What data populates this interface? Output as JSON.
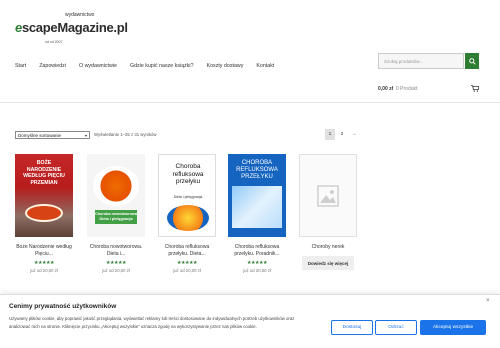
{
  "header": {
    "logo_top": "wydawnictwo",
    "logo_e": "e",
    "logo_rest_1": "scape",
    "logo_rest_2": "Magazine.pl",
    "logo_since": "od od 2007"
  },
  "nav": [
    "Start",
    "Zapowiedzi",
    "O wydawnictwie",
    "Gdzie kupić nasze książki?",
    "Koszty dostawy",
    "Kontakt"
  ],
  "search": {
    "placeholder": "Szukaj produktów..."
  },
  "cart": {
    "amount": "0,00 zł",
    "count": "0 Produkt"
  },
  "toolbar": {
    "sort_selected": "Domyślne sortowanie",
    "results": "Wyświetlanie 1–25 z 31 wyników",
    "pages": [
      "1",
      "2",
      "→"
    ]
  },
  "products": [
    {
      "title": "Boże Narodzenie według Pięciu...",
      "stars": "★★★★★",
      "price": "już od 20,00 zł",
      "cover_text": "BOŻE NARODZENIE WEDŁUG PIĘCIU PRZEMIAN"
    },
    {
      "title": "Choroba nowotworowa. Dieta i...",
      "stars": "★★★★★",
      "price": "już od 20,00 zł",
      "cover_text": "Choroba nowotworowa Dieta i pielęgnacja"
    },
    {
      "title": "Choroba refluksowa przełyku. Dieta...",
      "stars": "★★★★★",
      "price": "już od 20,00 zł",
      "cover_text": "Choroba refluksowa przełyku",
      "cover_sub": "Dieta i pielęgnacja"
    },
    {
      "title": "Choroba refluksowa przełyku. Poradnik...",
      "stars": "★★★★★",
      "price": "już od 20,00 zł",
      "cover_text": "CHOROBA REFLUKSOWA PRZEŁYKU"
    },
    {
      "title": "Choroby nerek",
      "button": "Dowiedz się więcej"
    }
  ],
  "cookie": {
    "title": "Cenimy prywatność użytkowników",
    "text": "Używamy plików cookie, aby poprawić jakość przeglądania, wyświetlać reklamy lub treści dostosowane do indywidualnych potrzeb użytkowników oraz analizować ruch na stronie. Kliknięcie przycisku „Akceptuj wszystkie” oznacza zgodę na wykorzystywanie przez nas plików cookie.",
    "customize": "Dostosuj",
    "reject": "Odrzuć",
    "accept": "Akceptuj wszystkie",
    "close": "×"
  },
  "colors": {
    "brand": "#2e7d32",
    "cookie_accent": "#1a73e8"
  }
}
